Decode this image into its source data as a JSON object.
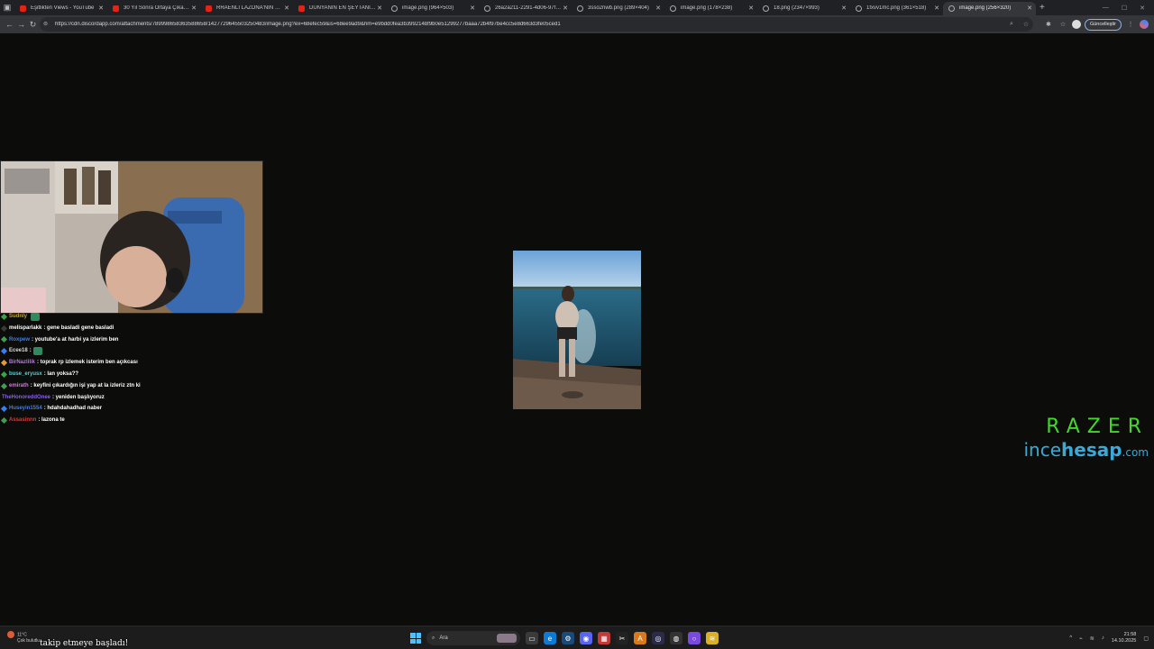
{
  "browser": {
    "tabs": [
      {
        "title": "Eşitlikten Views - YouTube",
        "favicon": "youtube-icon"
      },
      {
        "title": "30 Yıl Sonra Ortaya Çıkan G...",
        "favicon": "youtube-icon"
      },
      {
        "title": "RRAENLİ LAZONA'NIN EŞİ...",
        "favicon": "youtube-icon"
      },
      {
        "title": "DÜNYANIN EN ŞEYTANİ BA...",
        "favicon": "youtube-icon"
      },
      {
        "title": "image.png (964×503)",
        "favicon": "globe-icon"
      },
      {
        "title": "26a2a211-2291-4d06-97fc...",
        "favicon": "globe-icon"
      },
      {
        "title": "3sso2nwb.png (289×404)",
        "favicon": "globe-icon"
      },
      {
        "title": "image.png (178×238)",
        "favicon": "globe-icon"
      },
      {
        "title": "18.png (2347×993)",
        "favicon": "globe-icon"
      },
      {
        "title": "1fxvv1mc.png (361×518)",
        "favicon": "globe-icon"
      },
      {
        "title": "image.png (256×320)",
        "favicon": "globe-icon",
        "active": true
      }
    ],
    "url": "https://cdn.discordapp.com/attachments/789998658363588658/1427729645503250483/image.png?ex=68efec59&is=68ee9ad9&hm=e9bdd0fea3b399214bf9b0e51299277baaa72b4f97be4cc5e8d663d3fe05ced1",
    "update_button_label": "Güncelleştir"
  },
  "chat": [
    {
      "user": "Sudnly",
      "message": "",
      "color": "#c8a51e",
      "badge_color": "#3ea14a",
      "emote": true
    },
    {
      "user": "melisparlakk",
      "message": ": gene basladi gene basladi",
      "color": "#ffffff",
      "badge_color": "#3a3a3a",
      "emote": false
    },
    {
      "user": "Roxpew",
      "message": ": youtube'a at harbi ya izlerim ben",
      "color": "#3a7ff0",
      "badge_color": "#3ea14a",
      "emote": false
    },
    {
      "user": "Ecee18",
      "message": ": ",
      "color": "#d8d8d8",
      "badge_color": "#3a7ff0",
      "emote": true
    },
    {
      "user": "BirNazlilik",
      "message": ": toprak rp izlemek isterim ben açıkcası",
      "color": "#b27bd8",
      "badge_color": "#e89b2a",
      "emote": false
    },
    {
      "user": "buse_eryusx",
      "message": ": lan yoksa??",
      "color": "#4fd0d6",
      "badge_color": "#3ea14a",
      "emote": false
    },
    {
      "user": "emirath",
      "message": ": keyfini çıkardığın işi yap at la izleriz ztn ki",
      "color": "#d07ad8",
      "badge_color": "#3ea14a",
      "emote": false
    },
    {
      "user": "TheHonoreddOnee",
      "message": ": yeniden başlıyoruz",
      "color": "#8a5cf0",
      "badge_color": "",
      "emote": false
    },
    {
      "user": "Huseyin1554",
      "message": ": hdahdahadhad naber",
      "color": "#3a7ff0",
      "badge_color": "#3a7ff0",
      "emote": false
    },
    {
      "user": "Assasinnn",
      "message": ": lazona te",
      "color": "#d83a3a",
      "badge_color": "#3ea14a",
      "emote": false
    }
  ],
  "overlay": {
    "razer_logo": "RAZER",
    "ince": "ince",
    "hesap": "hesap",
    "com": ".com"
  },
  "taskbar": {
    "weather_temp": "11°C",
    "weather_text": "Çok bulutlu",
    "follow_alert": "takip etmeye başladı!",
    "search_placeholder": "Ara",
    "time": "21:58",
    "date": "14.10.2025"
  }
}
